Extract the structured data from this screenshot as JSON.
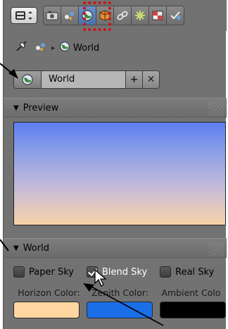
{
  "breadcrumb": {
    "world_label": "World"
  },
  "datablock": {
    "name": "World",
    "add_label": "+",
    "remove_label": "✕"
  },
  "preview_panel": {
    "title": "Preview"
  },
  "world_panel": {
    "title": "World",
    "checkboxes": [
      {
        "label": "Paper Sky",
        "checked": false
      },
      {
        "label": "Blend Sky",
        "checked": true
      },
      {
        "label": "Real Sky",
        "checked": false
      }
    ],
    "color_labels": [
      "Horizon Color:",
      "Zenith Color:",
      "Ambient Colo"
    ],
    "colors": {
      "horizon": "#ffd6a0",
      "zenith": "#1a6ee8",
      "ambient": "#000000"
    }
  },
  "tabs": [
    {
      "icon": "render-icon"
    },
    {
      "icon": "scene-icon"
    },
    {
      "icon": "world-icon",
      "active": true
    },
    {
      "icon": "object-icon"
    },
    {
      "icon": "constraints-icon"
    },
    {
      "icon": "modifiers-icon"
    },
    {
      "icon": "texture-icon"
    },
    {
      "icon": "physics-icon"
    }
  ],
  "colors": {
    "panel_bg": "#727272",
    "active_tab": "#4a72ad",
    "highlight": "#d01010"
  }
}
